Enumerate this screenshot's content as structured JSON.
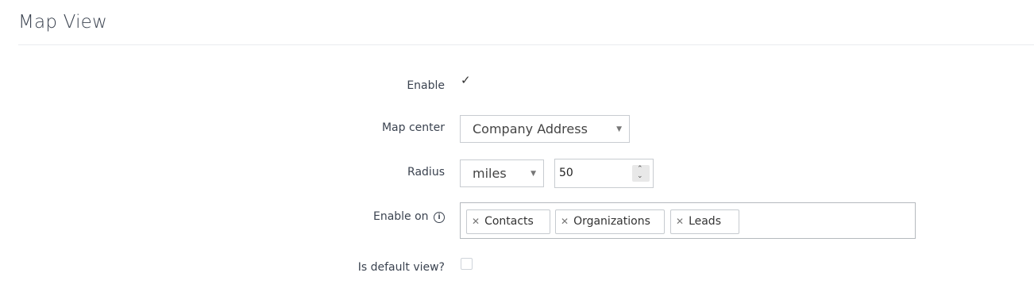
{
  "section": {
    "title": "Map View"
  },
  "fields": {
    "enable": {
      "label": "Enable",
      "checked": true
    },
    "map_center": {
      "label": "Map center",
      "value": "Company Address"
    },
    "radius": {
      "label": "Radius",
      "unit": "miles",
      "value": "50"
    },
    "enable_on": {
      "label": "Enable on",
      "tags": [
        "Contacts",
        "Organizations",
        "Leads"
      ]
    },
    "is_default_view": {
      "label": "Is default view?",
      "checked": false
    }
  },
  "icons": {
    "checkmark": "check-icon",
    "info": "info-icon",
    "dropdown": "caret-down-icon",
    "remove_tag": "x-icon",
    "spinner": "spinner-icon"
  }
}
